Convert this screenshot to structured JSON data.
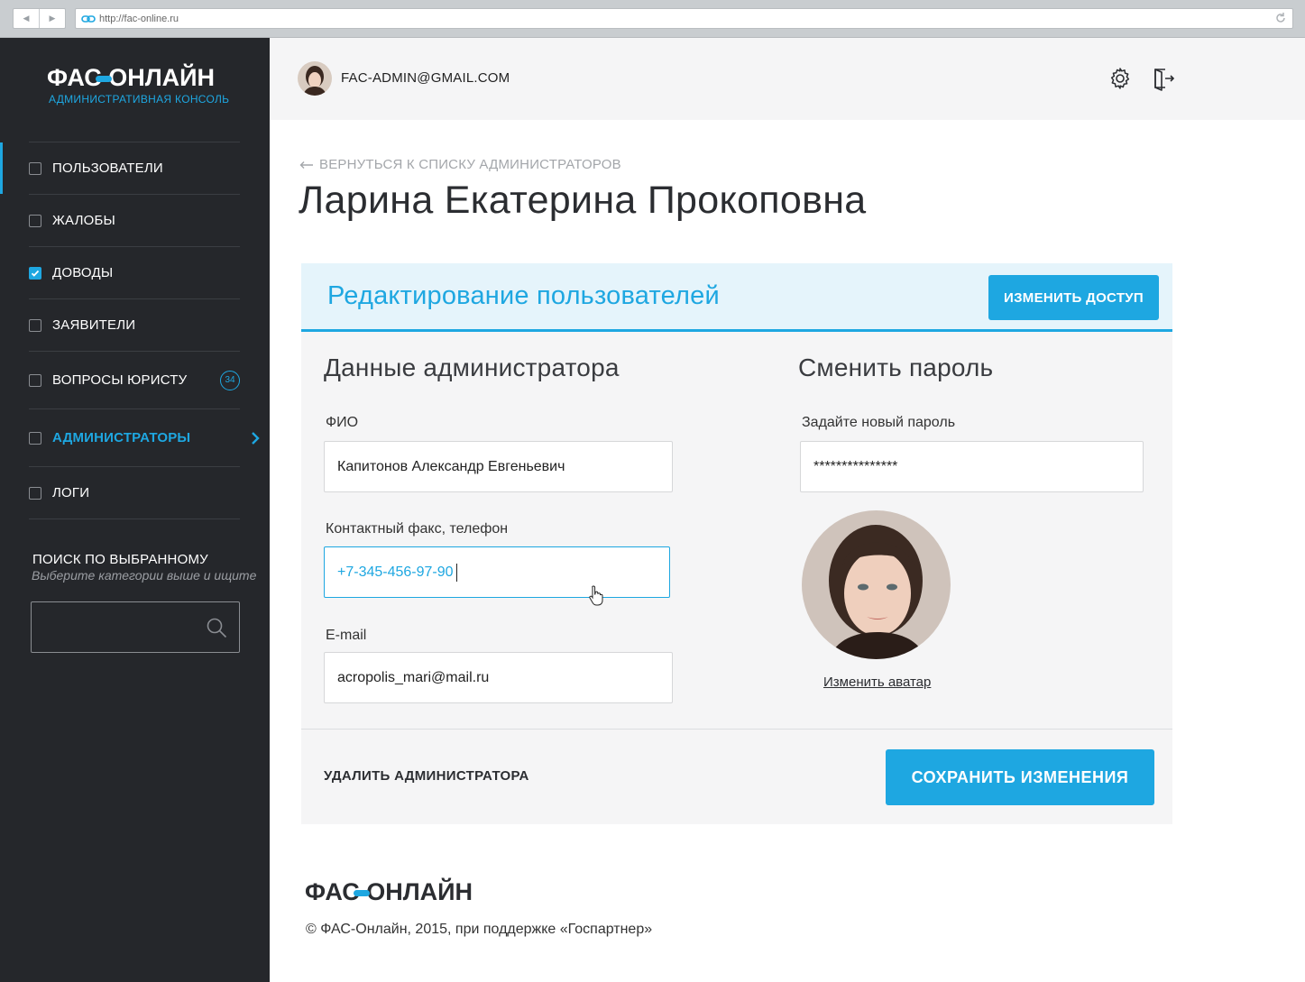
{
  "browser": {
    "url": "http://fac-online.ru"
  },
  "sidebar": {
    "logo_text": "ФАС ОНЛАЙН",
    "logo_subtitle": "АДМИНИСТРАТИВНАЯ КОНСОЛЬ",
    "items": [
      {
        "label": "ПОЛЬЗОВАТЕЛИ",
        "checked": false
      },
      {
        "label": "ЖАЛОБЫ",
        "checked": false
      },
      {
        "label": "ДОВОДЫ",
        "checked": true
      },
      {
        "label": "ЗАЯВИТЕЛИ",
        "checked": false
      },
      {
        "label": "ВОПРОСЫ ЮРИСТУ",
        "checked": false,
        "badge": "34"
      },
      {
        "label": "АДМИНИСТРАТОРЫ",
        "checked": false,
        "selected": true
      },
      {
        "label": "ЛОГИ",
        "checked": false
      }
    ],
    "search": {
      "title": "ПОИСК ПО ВЫБРАННОМУ",
      "hint": "Выберите категории выше и ищите",
      "value": ""
    }
  },
  "header": {
    "user_email": "FAC-ADMIN@GMAIL.COM"
  },
  "main": {
    "back_link": "ВЕРНУТЬСЯ К СПИСКУ АДМИНИСТРАТОРОВ",
    "page_title": "Ларина Екатерина Прокоповна",
    "card": {
      "title": "Редактирование пользователей",
      "access_button": "ИЗМЕНИТЬ ДОСТУП",
      "admin_section": {
        "title": "Данные администратора",
        "fio_label": "ФИО",
        "fio_value": "Капитонов Александр Евгеньевич",
        "phone_label": "Контактный факс, телефон",
        "phone_value": "+7-345-456-97-90",
        "email_label": "E-mail",
        "email_value": "acropolis_mari@mail.ru"
      },
      "password_section": {
        "title": "Сменить пароль",
        "password_label": "Задайте новый пароль",
        "password_value": "***************",
        "avatar_link": "Изменить аватар"
      },
      "delete_button": "УДАЛИТЬ АДМИНИСТРАТОРА",
      "save_button": "СОХРАНИТЬ ИЗМЕНЕНИЯ"
    }
  },
  "footer": {
    "logo_text": "ФАС ОНЛАЙН",
    "copyright": "© ФАС-Онлайн, 2015, при поддержке «Госпартнер»"
  },
  "colors": {
    "accent": "#1ea7e1",
    "sidebar_bg": "#25272b",
    "card_bg": "#f5f5f6",
    "card_head_bg": "#e5f4fb"
  }
}
